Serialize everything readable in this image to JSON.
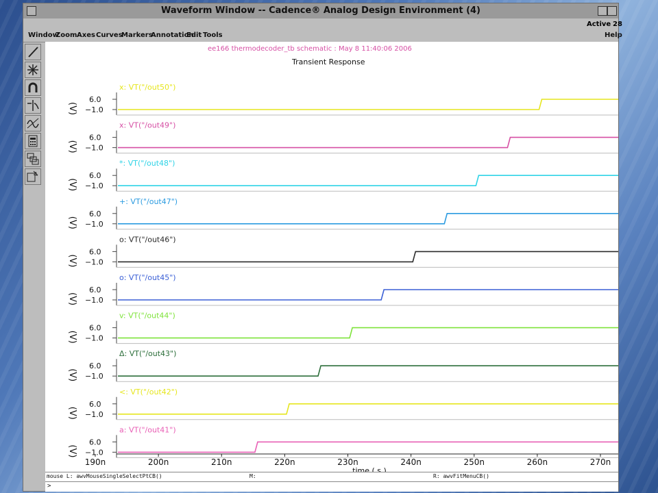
{
  "window": {
    "title": "Waveform Window -- Cadence® Analog Design Environment (4)",
    "status_active": "Active",
    "status_right": "28"
  },
  "menubar": {
    "items": [
      "Window",
      "Zoom",
      "Axes",
      "Curves",
      "Markers",
      "Annotation",
      "Edit",
      "Tools"
    ],
    "help": "Help"
  },
  "toolbar": {
    "icons": [
      "pen-icon",
      "crosshair-icon",
      "magnet-icon",
      "waveform-split-icon",
      "sine-wave-icon",
      "calculator-icon",
      "stack-icon",
      "zoom-box-icon"
    ]
  },
  "bottom": {
    "mouse_left": "mouse L: awvMouseSingleSelectPtCB()",
    "mouse_middle": "M:",
    "mouse_right": "R: awvFitMenuCB()",
    "prompt": ">"
  },
  "chart_data": {
    "type": "line",
    "subtitle": "ee166 thermodecoder_tb schematic : May  8 11:40:06 2006",
    "title": "Transient Response",
    "xlabel": "time ( s )",
    "ylabel": "V",
    "xlim": [
      190,
      270
    ],
    "x_ticks": [
      "190n",
      "200n",
      "210n",
      "220n",
      "230n",
      "240n",
      "250n",
      "260n",
      "270n"
    ],
    "y_ticks": [
      "6.0",
      "-1.0"
    ],
    "ylim": [
      -1.0,
      6.0
    ],
    "grid": false,
    "colors": {
      "yellow": "#e6e61e",
      "magenta": "#d64fa4",
      "cyan": "#2fd3e6",
      "skyblue": "#2b9be0",
      "black": "#2a2a2a",
      "blue": "#3a5fd6",
      "green": "#7ee33a",
      "darkgreen": "#2c6e3a",
      "pink": "#e85fb5"
    },
    "series": [
      {
        "name": "VT(\"/out50\")",
        "marker": "x",
        "color": "#e6e61e",
        "rise_x": 260.5,
        "low": -1.0,
        "high": 6.0
      },
      {
        "name": "VT(\"/out49\")",
        "marker": "x",
        "color": "#d64fa4",
        "rise_x": 255.5,
        "low": -1.0,
        "high": 6.0
      },
      {
        "name": "VT(\"/out48\")",
        "marker": "*",
        "color": "#2fd3e6",
        "rise_x": 250.5,
        "low": -1.0,
        "high": 6.0
      },
      {
        "name": "VT(\"/out47\")",
        "marker": "+",
        "color": "#2b9be0",
        "rise_x": 245.5,
        "low": -1.0,
        "high": 6.0
      },
      {
        "name": "VT(\"/out46\")",
        "marker": "o",
        "color": "#2a2a2a",
        "rise_x": 240.5,
        "low": -1.0,
        "high": 6.0
      },
      {
        "name": "VT(\"/out45\")",
        "marker": "o",
        "color": "#3a5fd6",
        "rise_x": 235.5,
        "low": -1.0,
        "high": 6.0
      },
      {
        "name": "VT(\"/out44\")",
        "marker": "v",
        "color": "#7ee33a",
        "rise_x": 230.5,
        "low": -1.0,
        "high": 6.0
      },
      {
        "name": "VT(\"/out43\")",
        "marker": "Δ",
        "color": "#2c6e3a",
        "rise_x": 225.5,
        "low": -1.0,
        "high": 6.0
      },
      {
        "name": "VT(\"/out42\")",
        "marker": "<",
        "color": "#e6e61e",
        "rise_x": 220.5,
        "low": -1.0,
        "high": 6.0
      },
      {
        "name": "VT(\"/out41\")",
        "marker": "a",
        "color": "#e85fb5",
        "rise_x": 215.5,
        "low": -1.0,
        "high": 6.0
      }
    ]
  }
}
